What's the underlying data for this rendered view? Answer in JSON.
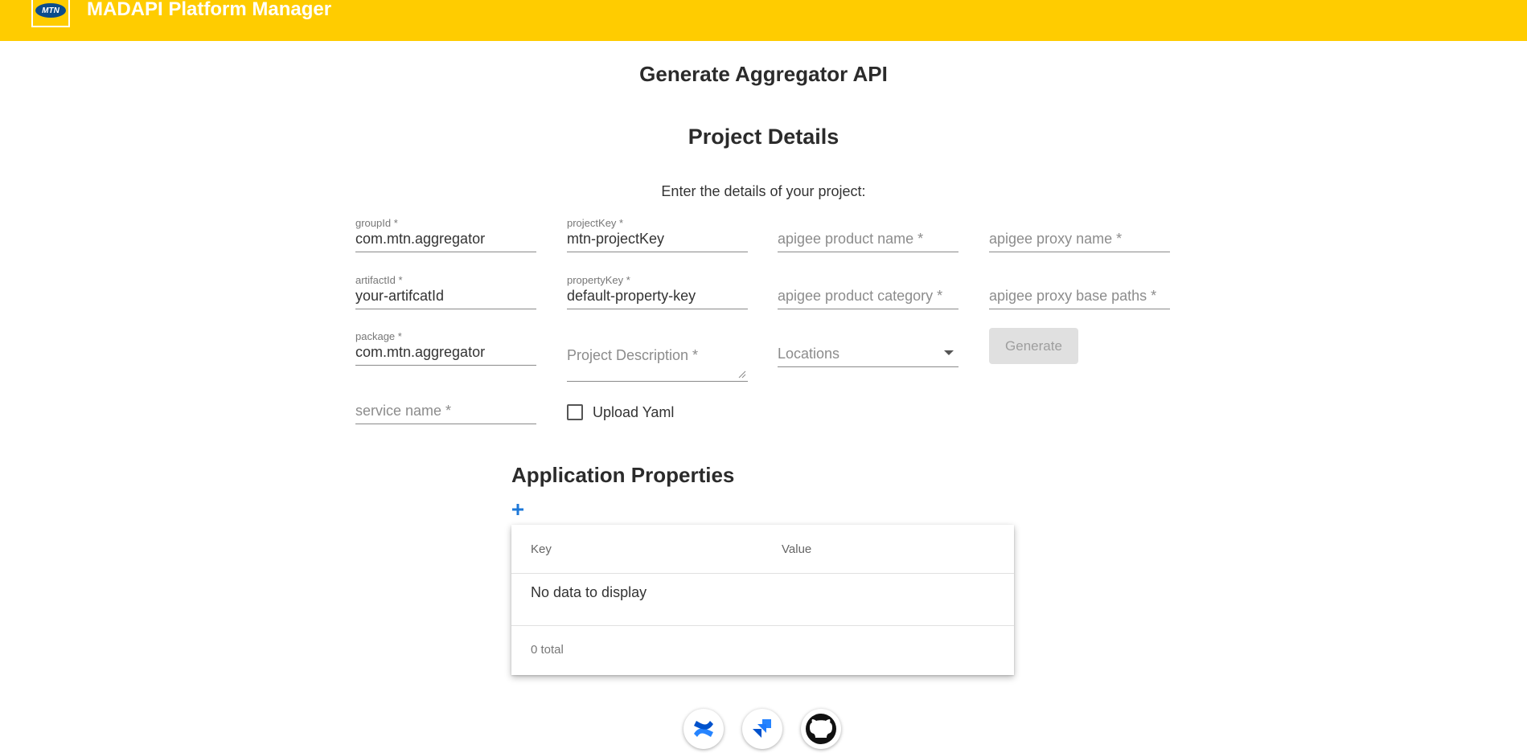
{
  "header": {
    "logo_text": "MTN",
    "app_title": "MADAPI Platform Manager",
    "brand_color": "#ffcc00"
  },
  "page": {
    "title": "Generate Aggregator API",
    "section_title": "Project Details",
    "intro": "Enter the details of your project:"
  },
  "form": {
    "groupId": {
      "label": "groupId *",
      "value": "com.mtn.aggregator"
    },
    "projectKey": {
      "label": "projectKey *",
      "value": "mtn-projectKey"
    },
    "apigee_product_name": {
      "placeholder": "apigee product name *"
    },
    "apigee_proxy_name": {
      "placeholder": "apigee proxy name *"
    },
    "artifactId": {
      "label": "artifactId *",
      "value": "your-artifcatId"
    },
    "propertyKey": {
      "label": "propertyKey *",
      "value": "default-property-key"
    },
    "apigee_product_category": {
      "placeholder": "apigee product category *"
    },
    "apigee_proxy_base_paths": {
      "placeholder": "apigee proxy base paths *"
    },
    "package": {
      "label": "package *",
      "value": "com.mtn.aggregator"
    },
    "project_description": {
      "placeholder": "Project Description *"
    },
    "locations": {
      "placeholder": "Locations"
    },
    "generate_label": "Generate",
    "service_name": {
      "placeholder": "service name *"
    },
    "upload_yaml_label": "Upload Yaml"
  },
  "app_properties": {
    "title": "Application Properties",
    "add_icon": "plus-icon",
    "columns": [
      "Key",
      "Value"
    ],
    "empty_text": "No data to display",
    "total_text": "0 total"
  },
  "footer_icons": [
    "confluence-icon",
    "jira-icon",
    "github-icon"
  ]
}
